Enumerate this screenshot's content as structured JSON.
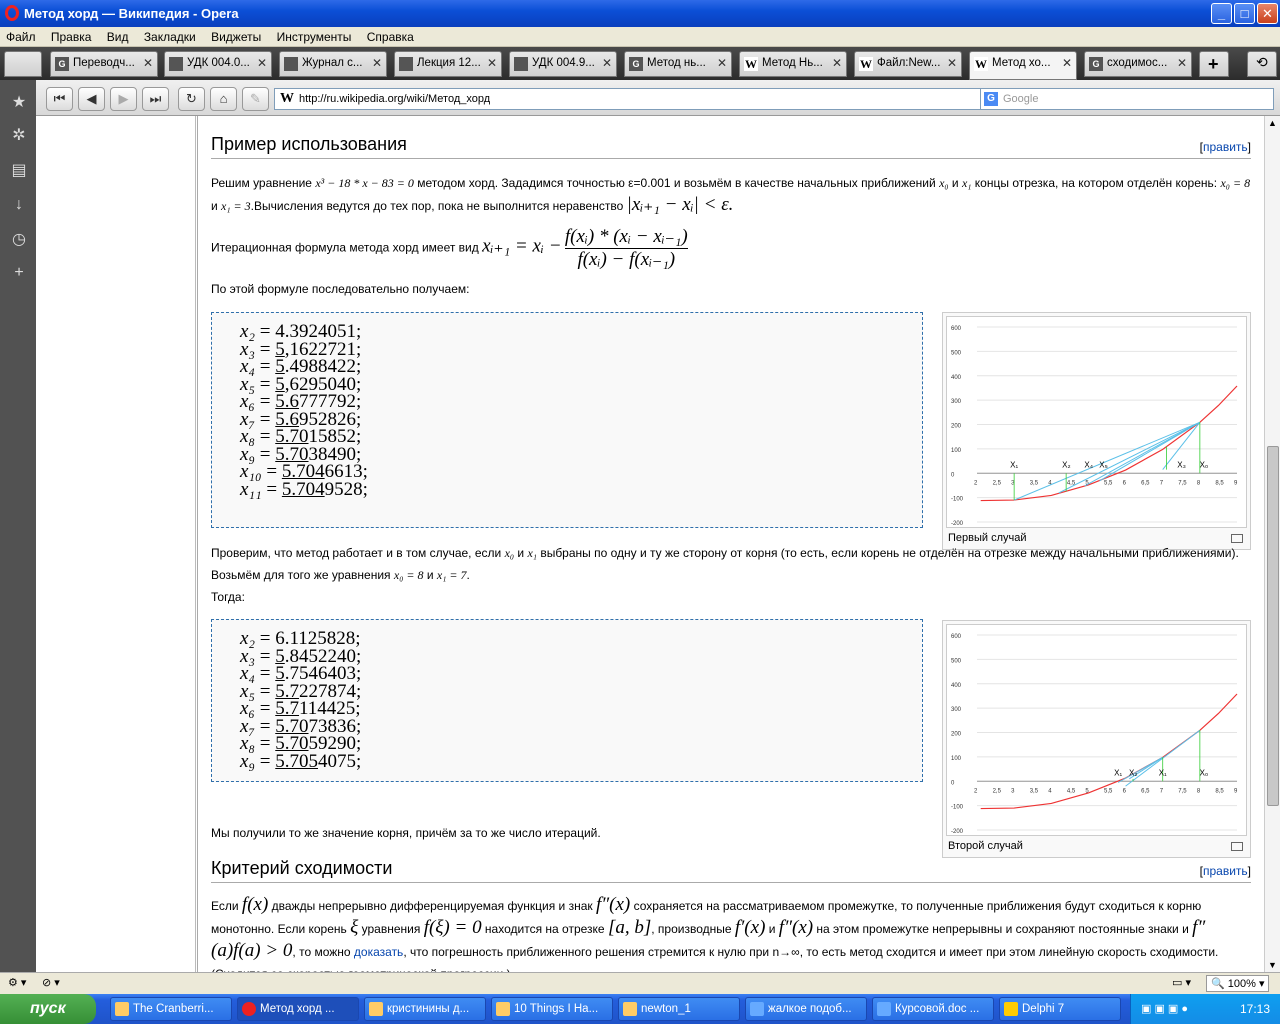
{
  "window": {
    "title": "Метод хорд — Википедия - Opera",
    "min": "_",
    "max": "□",
    "close": "✕"
  },
  "menu": [
    "Файл",
    "Правка",
    "Вид",
    "Закладки",
    "Виджеты",
    "Инструменты",
    "Справка"
  ],
  "tabs": [
    {
      "label": "Переводч...",
      "icon": "google-icon"
    },
    {
      "label": "УДК 004.0...",
      "icon": "page-icon"
    },
    {
      "label": "Журнал с...",
      "icon": "page-icon"
    },
    {
      "label": "Лекция 12...",
      "icon": "site-icon"
    },
    {
      "label": "УДК 004.9...",
      "icon": "page-icon"
    },
    {
      "label": "Метод нь...",
      "icon": "google-icon"
    },
    {
      "label": "Метод Нь...",
      "icon": "wikipedia-icon"
    },
    {
      "label": "Файл:New...",
      "icon": "wikipedia-icon"
    },
    {
      "label": "Метод хо...",
      "icon": "wikipedia-icon",
      "active": true
    },
    {
      "label": "сходимос...",
      "icon": "google-icon"
    }
  ],
  "address": {
    "url": "http://ru.wikipedia.org/wiki/Метод_хорд",
    "search_placeholder": "Google"
  },
  "article": {
    "sec1_title": "Пример использования",
    "edit_label": "править",
    "p1a": "Решим уравнение",
    "p1_eq": "x³ − 18 * x − 83 = 0",
    "p1b": "методом хорд. Зададимся точностью ε=0.001 и возьмём в качестве начальных приближений",
    "p1c": "и",
    "p1d": "концы отрезка, на котором отделён",
    "p1e": "корень:",
    "p1f": "x₀ = 8",
    "p1g": "и",
    "p1h": "x₁ = 3",
    "p1i": ".Вычисления ведутся до тех пор, пока не выполнится неравенство",
    "p1_ineq": "|xᵢ₊₁ − xᵢ| < ε.",
    "x0": "x₀",
    "x1": "x₁",
    "p2": "Итерационная формула метода хорд имеет вид",
    "p2_lhs": "xᵢ₊₁ = xᵢ −",
    "p2_num": "f(xᵢ) * (xᵢ − xᵢ₋₁)",
    "p2_den": "f(xᵢ) − f(xᵢ₋₁)",
    "p3": "По этой формуле последовательно получаем:",
    "seq1": [
      {
        "lhs": "x₂",
        "pre": "",
        "u": "",
        "rest": "4.3924051;"
      },
      {
        "lhs": "x₃",
        "pre": "",
        "u": "5",
        "rest": ",1622721;"
      },
      {
        "lhs": "x₄",
        "pre": "",
        "u": "5",
        "rest": ".4988422;"
      },
      {
        "lhs": "x₅",
        "pre": "",
        "u": "5",
        "rest": ",6295040;"
      },
      {
        "lhs": "x₆",
        "pre": "",
        "u": "5.6",
        "rest": "777792;"
      },
      {
        "lhs": "x₇",
        "pre": "",
        "u": "5.6",
        "rest": "952826;"
      },
      {
        "lhs": "x₈",
        "pre": "",
        "u": "5.70",
        "rest": "15852;"
      },
      {
        "lhs": "x₉",
        "pre": "",
        "u": "5.70",
        "rest": "38490;"
      },
      {
        "lhs": "x₁₀",
        "pre": "",
        "u": "5.704",
        "rest": "6613;"
      },
      {
        "lhs": "x₁₁",
        "pre": "",
        "u": "5.704",
        "rest": "9528;"
      }
    ],
    "p4a": "Проверим, что метод работает и в том случае, если",
    "p4b": "и",
    "p4c": "выбраны по одну и ту же сторону от корня (то есть, если",
    "p4d": "корень не отделён на отрезке между начальными приближениями). Возьмём для того же уравнения",
    "p4e": "x₀ = 8",
    "p4f": "и",
    "p4g": "x₁ = 7",
    "p4h": ".",
    "p4i": "Тогда:",
    "seq2": [
      {
        "lhs": "x₂",
        "u": "",
        "rest": "6.1125828;"
      },
      {
        "lhs": "x₃",
        "u": "5",
        "rest": ".8452240;"
      },
      {
        "lhs": "x₄",
        "u": "5",
        "rest": ".7546403;"
      },
      {
        "lhs": "x₅",
        "u": "5.7",
        "rest": "227874;"
      },
      {
        "lhs": "x₆",
        "u": "5.7",
        "rest": "114425;"
      },
      {
        "lhs": "x₇",
        "u": "5.70",
        "rest": "73836;"
      },
      {
        "lhs": "x₈",
        "u": "5.70",
        "rest": "59290;"
      },
      {
        "lhs": "x₉",
        "u": "5.705",
        "rest": "4075;"
      }
    ],
    "p5": "Мы получили то же значение корня, причём за то же число итераций.",
    "sec2_title": "Критерий сходимости",
    "p6a": "Если",
    "p6_fx": "f(x)",
    "p6b": "дважды непрерывно дифференцируемая функция и знак",
    "p6_f2": "f″(x)",
    "p6c": "сохраняется на рассматриваемом промежутке, то полученные приближения будут сходиться",
    "p6d": "к корню монотонно. Если корень",
    "p6_xi": "ξ",
    "p6e": "уравнения",
    "p6_eq": "f(ξ) = 0",
    "p6f": "находится на отрезке",
    "p6_ab": "[a, b]",
    "p6g": ", производные",
    "p6_f1": "f′(x)",
    "p6h": "и",
    "p6_f22": "f″(x)",
    "p6i": "на этом промежутке непрерывны и сохраняют",
    "p6j": "постоянные знаки и",
    "p6_cond": "f″(a)f(a) > 0",
    "p6k": ", то можно",
    "p6_link": "доказать",
    "p6l": ", что погрешность приближенного решения стремится к нулю при n→∞, то есть метод сходится и имеет при",
    "p6m": "этом линейную скорость сходимости. (Сходится со скоростью геометрической прогрессии.)"
  },
  "thumbs": [
    {
      "caption": "Первый случай"
    },
    {
      "caption": "Второй случай"
    }
  ],
  "chart_data": [
    {
      "type": "line",
      "title": "",
      "xlabel": "",
      "ylabel": "",
      "x_ticks": [
        "2",
        "2,5",
        "3",
        "3,5",
        "4",
        "4,5",
        "5",
        "5,5",
        "6",
        "6,5",
        "7",
        "7,5",
        "8",
        "8,5",
        "9"
      ],
      "y_ticks": [
        "-200",
        "-100",
        "0",
        "100",
        "200",
        "300",
        "400",
        "500",
        "600"
      ],
      "ylim": [
        -200,
        600
      ],
      "xlim": [
        2,
        9
      ],
      "point_labels": [
        "X₁",
        "X₂",
        "X₄",
        "X₅",
        "X₃",
        "X₀"
      ],
      "series": [
        {
          "color": "#e33",
          "x": [
            2.1,
            3,
            4,
            5,
            6,
            7,
            8,
            8.5,
            9
          ],
          "values": [
            -112,
            -110,
            -91,
            -48,
            13,
            98,
            209,
            278,
            358
          ]
        }
      ]
    },
    {
      "type": "line",
      "title": "",
      "xlabel": "",
      "ylabel": "",
      "x_ticks": [
        "2",
        "2,5",
        "3",
        "3,5",
        "4",
        "4,5",
        "5",
        "5,5",
        "6",
        "6,5",
        "7",
        "7,5",
        "8",
        "8,5",
        "9"
      ],
      "y_ticks": [
        "-200",
        "-100",
        "0",
        "100",
        "200",
        "300",
        "400",
        "500",
        "600"
      ],
      "ylim": [
        -200,
        600
      ],
      "xlim": [
        2,
        9
      ],
      "point_labels": [
        "X₁",
        "X₂",
        "X₁",
        "X₀"
      ],
      "series": [
        {
          "color": "#e33",
          "x": [
            2.1,
            3,
            4,
            5,
            6,
            7,
            8,
            8.5,
            9
          ],
          "values": [
            -112,
            -110,
            -91,
            -48,
            13,
            98,
            209,
            278,
            358
          ]
        }
      ]
    }
  ],
  "status": {
    "zoom": "100%"
  },
  "taskbar": {
    "start": "пуск",
    "tasks": [
      "The Cranberri...",
      "Метод хорд ...",
      "кристинины д...",
      "10 Things I Ha...",
      "newton_1",
      "жалкое подоб...",
      "Курсовой.doc ...",
      "Delphi 7"
    ],
    "lang": "RU",
    "clock": "17:13"
  }
}
